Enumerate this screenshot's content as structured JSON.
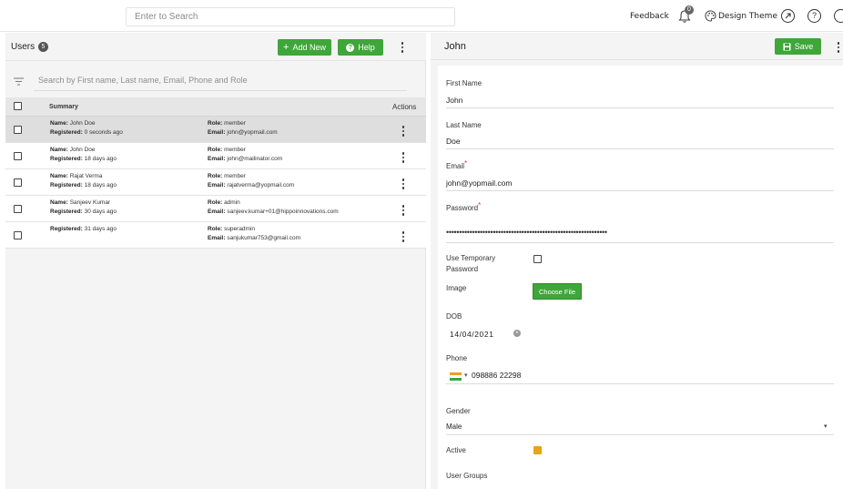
{
  "topbar": {
    "search_placeholder": "Enter to Search",
    "feedback_label": "Feedback",
    "notification_count": "0",
    "design_theme_label": "Design Theme",
    "question_icon_label": "?"
  },
  "users_panel": {
    "title": "Users",
    "count": "5",
    "add_new_label": "Add New",
    "help_label": "Help",
    "filter_placeholder": "Search by First name, Last name, Email, Phone and Role",
    "columns": {
      "summary": "Summary",
      "actions": "Actions"
    },
    "rows": [
      {
        "name": "John Doe",
        "registered": "0 seconds ago",
        "role": "member",
        "email": "john@yopmail.com",
        "selected": true
      },
      {
        "name": "John Doe",
        "registered": "18 days ago",
        "role": "member",
        "email": "john@mailinator.com",
        "selected": false
      },
      {
        "name": "Rajat Verma",
        "registered": "18 days ago",
        "role": "member",
        "email": "rajatverma@yopmail.com",
        "selected": false
      },
      {
        "name": "Sanjeev Kumar",
        "registered": "30 days ago",
        "role": "admin",
        "email": "sanjeev.kumar+01@hippoinnovations.com",
        "selected": false
      },
      {
        "name": "",
        "registered": "31 days ago",
        "role": "superadmin",
        "email": "sanjukumar753@gmail.com",
        "selected": false
      }
    ],
    "labels": {
      "name": "Name:",
      "registered": "Registered:",
      "role": "Role:",
      "email": "Email:"
    }
  },
  "detail_panel": {
    "title": "John",
    "save_label": "Save",
    "fields": {
      "first_name_label": "First Name",
      "first_name_value": "John",
      "last_name_label": "Last Name",
      "last_name_value": "Doe",
      "email_label": "Email",
      "email_value": "john@yopmail.com",
      "password_label": "Password",
      "password_value": "••••••••••••••••••••••••••••••••••••••••••••••••••••••••••••••",
      "temp_password_label_1": "Use Temporary",
      "temp_password_label_2": "Password",
      "image_label": "Image",
      "choose_file_label": "Choose File",
      "dob_label": "DOB",
      "dob_value": "14/04/2021",
      "phone_label": "Phone",
      "phone_value": "098886 22298",
      "gender_label": "Gender",
      "gender_value": "Male",
      "active_label": "Active",
      "user_groups_label": "User Groups",
      "required_mark": "*"
    }
  },
  "colors": {
    "accent_green": "#3fa63a",
    "active_checkbox": "#e8a317",
    "required": "#dd3333"
  }
}
